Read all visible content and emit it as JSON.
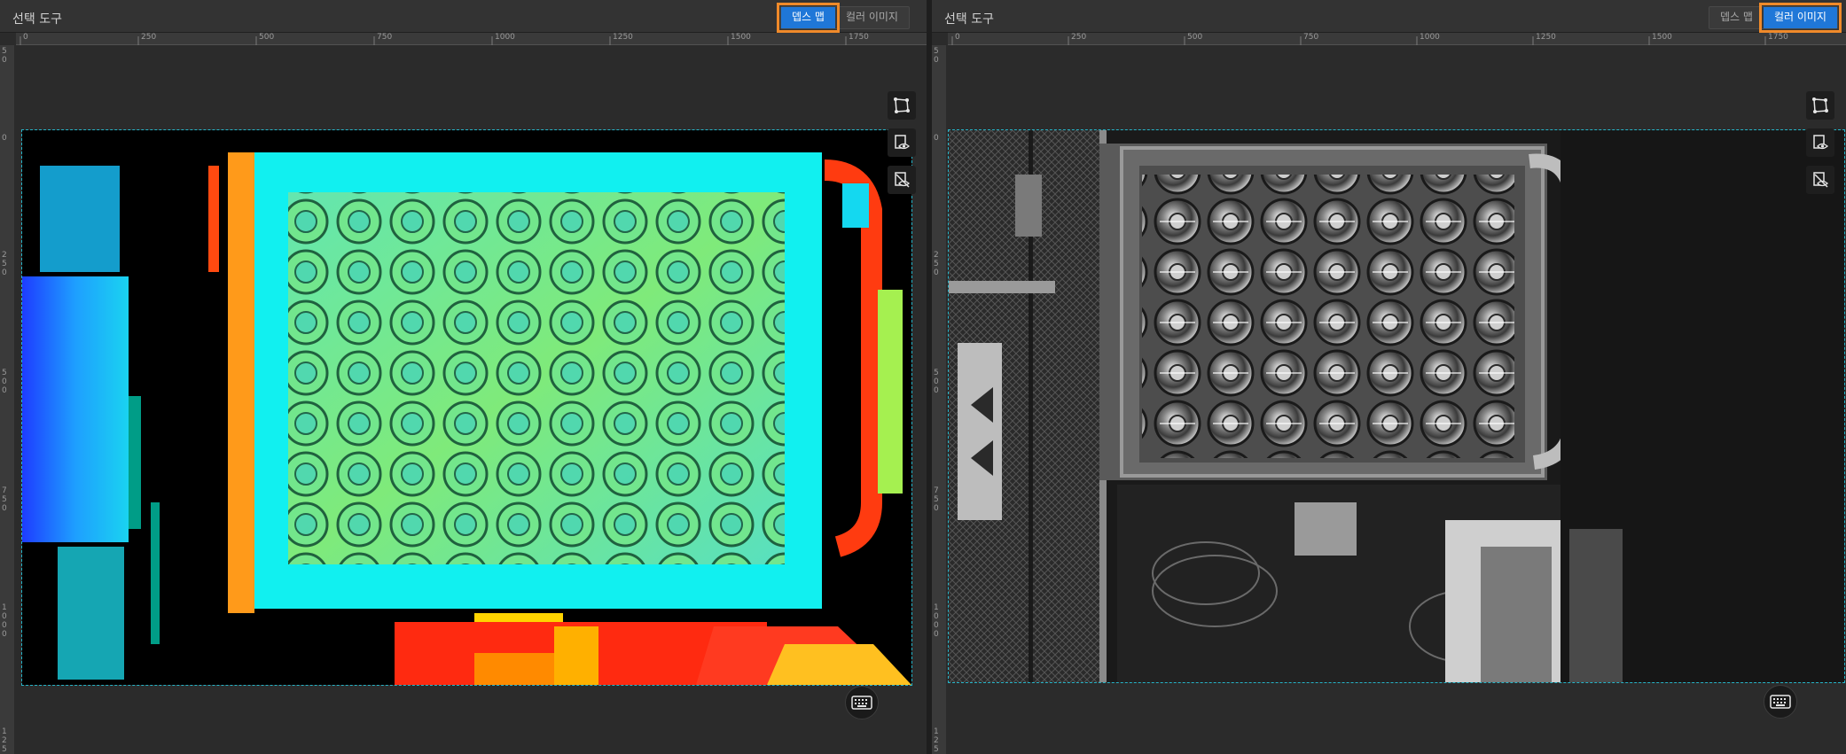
{
  "left_panel": {
    "title": "선택 도구",
    "tabs": [
      {
        "label": "뎁스 맵",
        "active": true
      },
      {
        "label": "컬러 이미지",
        "active": false
      }
    ],
    "ruler_top": [
      "0",
      "250",
      "500",
      "750",
      "1000",
      "1250",
      "1500",
      "1750"
    ],
    "ruler_left": [
      "5 0",
      "0",
      "2 5 0",
      "5 0 0",
      "7 5 0",
      "1 0 0 0",
      "1 2 5"
    ],
    "image": "depth-map"
  },
  "right_panel": {
    "title": "선택 도구",
    "tabs": [
      {
        "label": "뎁스 맵",
        "active": false
      },
      {
        "label": "컬러 이미지",
        "active": true
      }
    ],
    "ruler_top": [
      "0",
      "250",
      "500",
      "750",
      "1000",
      "1250",
      "1500",
      "1750"
    ],
    "ruler_left": [
      "5 0",
      "0",
      "2 5 0",
      "5 0 0",
      "7 5 0",
      "1 0 0 0",
      "1 2 5"
    ],
    "image": "grayscale-color-image"
  },
  "icons": {
    "roi_tool": "roi-polygon-icon",
    "view_toggle": "view-eye-icon",
    "hide_toggle": "hide-eye-icon",
    "keyboard": "keyboard-icon"
  },
  "colors": {
    "accent": "#1f77d8",
    "highlight": "#f08a2a",
    "roi_border": "#25b4c8"
  }
}
